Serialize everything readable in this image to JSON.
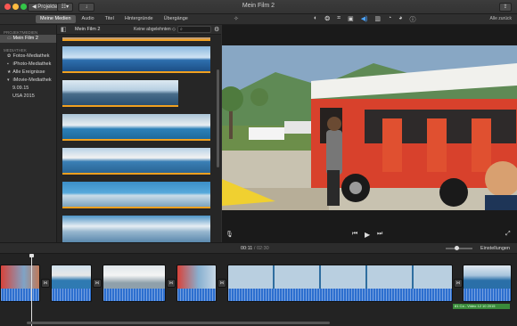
{
  "window": {
    "title": "Mein Film 2",
    "back_label": "◀ Projekte",
    "share_icon": "share-icon"
  },
  "toolbar": {
    "tabs": [
      {
        "label": "Meine Medien",
        "active": true
      },
      {
        "label": "Audio",
        "active": false
      },
      {
        "label": "Titel",
        "active": false
      },
      {
        "label": "Hintergründe",
        "active": false
      },
      {
        "label": "Übergänge",
        "active": false
      }
    ],
    "reset_all": "Alle zurück",
    "active_tool_color": "#4aa3ff"
  },
  "sidebar": {
    "sections": [
      {
        "header": "Projektmedien",
        "items": [
          {
            "label": "Mein Film 2",
            "selected": true,
            "icon": "film-icon"
          }
        ]
      },
      {
        "header": "Mediathek",
        "items": [
          {
            "label": "Fotos-Mediathek",
            "icon": "photos-icon"
          },
          {
            "label": "iPhoto-Mediathek",
            "icon": "iphoto-icon"
          },
          {
            "label": "Alle Ereignisse",
            "icon": "star-icon"
          },
          {
            "label": "iMovie-Mediathek",
            "icon": "imovie-icon"
          },
          {
            "label": "9.09.15",
            "icon": ""
          },
          {
            "label": "USA 2015",
            "icon": ""
          }
        ]
      }
    ]
  },
  "browser": {
    "title": "Mein Film 2",
    "filter": "Keine abgelehnten ◇",
    "search_placeholder": "",
    "accent": "#f0a020"
  },
  "timeline": {
    "current_time": "00:11",
    "total_time": "02:30",
    "settings_label": "Einstellungen",
    "audio_color": "#2d6fcf",
    "green_label": "81 Ca - Video 12 10 2015"
  }
}
